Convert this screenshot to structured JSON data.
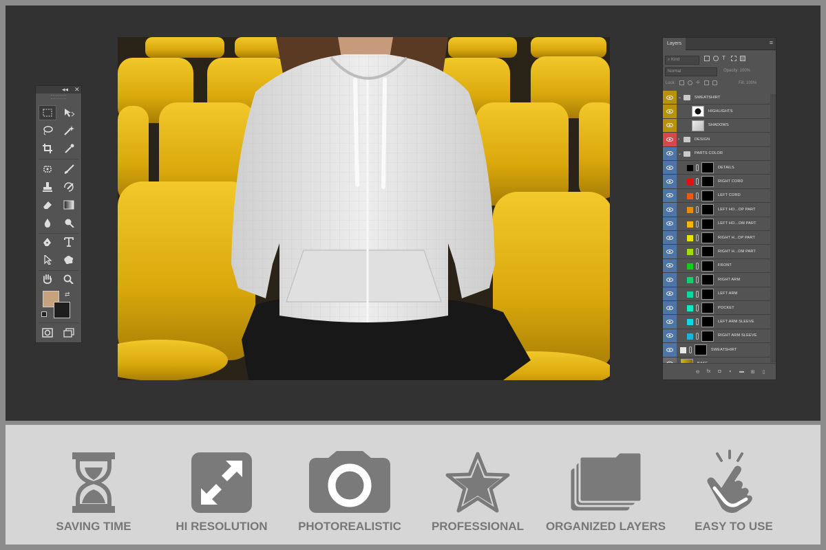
{
  "tools_panel": {
    "collapse_label": "◂◂",
    "close_label": "✕",
    "foreground_color": "#c7a37d",
    "background_color": "#1e1e1e"
  },
  "layers_panel": {
    "tab_label": "Layers",
    "filter_label": "Kind",
    "blend_mode": "Normal",
    "opacity_label": "Opacity: 100%",
    "lock_label": "Lock:",
    "fill_label": "Fill: 100%",
    "layers": [
      {
        "name": "SWEATSHIRT",
        "type": "group",
        "expanded": true,
        "tag_color": "#b8920a",
        "indent": 0
      },
      {
        "name": "HIGHLIGHTS",
        "type": "thumb",
        "tag_color": "#b8920a",
        "indent": 1
      },
      {
        "name": "SHADOWS",
        "type": "thumb",
        "tag_color": "#b8920a",
        "indent": 1
      },
      {
        "name": "DESIGN",
        "type": "group",
        "expanded": false,
        "tag_color": "#d34a4a",
        "indent": 0
      },
      {
        "name": "PARTS COLOR",
        "type": "group",
        "expanded": true,
        "tag_color": "#4d75a8",
        "indent": 0
      },
      {
        "name": "DETAILS",
        "type": "color",
        "swatch": "#000000",
        "tag_color": "#4d75a8",
        "indent": 1
      },
      {
        "name": "RIGHT CORD",
        "type": "color",
        "swatch": "#e31010",
        "tag_color": "#4d75a8",
        "indent": 1
      },
      {
        "name": "LEFT CORD",
        "type": "color",
        "swatch": "#f05a0a",
        "tag_color": "#4d75a8",
        "indent": 1
      },
      {
        "name": "LEFT HO...OP PART",
        "type": "color",
        "swatch": "#f28a00",
        "tag_color": "#4d75a8",
        "indent": 1
      },
      {
        "name": "LEFT HO...OM PART",
        "type": "color",
        "swatch": "#f5b800",
        "tag_color": "#4d75a8",
        "indent": 1
      },
      {
        "name": "RIGHT H...OP PART",
        "type": "color",
        "swatch": "#f0e000",
        "tag_color": "#4d75a8",
        "indent": 1
      },
      {
        "name": "RIGHT H...OM PART",
        "type": "color",
        "swatch": "#a0e000",
        "tag_color": "#4d75a8",
        "indent": 1
      },
      {
        "name": "FRONT",
        "type": "color",
        "swatch": "#10d010",
        "tag_color": "#4d75a8",
        "indent": 1
      },
      {
        "name": "RIGHT ARM",
        "type": "color",
        "swatch": "#10d070",
        "tag_color": "#4d75a8",
        "indent": 1
      },
      {
        "name": "LEFT ARM",
        "type": "color",
        "swatch": "#10d8a0",
        "tag_color": "#4d75a8",
        "indent": 1
      },
      {
        "name": "POCKET",
        "type": "color",
        "swatch": "#10e8c8",
        "tag_color": "#4d75a8",
        "indent": 1
      },
      {
        "name": "LEFT ARM SLEEVE",
        "type": "color",
        "swatch": "#10d8e8",
        "tag_color": "#4d75a8",
        "indent": 1
      },
      {
        "name": "RIGHT ARM SLEEVE",
        "type": "color",
        "swatch": "#10b8e8",
        "tag_color": "#4d75a8",
        "indent": 1
      },
      {
        "name": "SWEATSHIRT",
        "type": "color",
        "swatch": "#e8e8e8",
        "tag_color": "#4d75a8",
        "indent": 0
      },
      {
        "name": "BASE",
        "type": "base",
        "tag_color": "#6a6a6a",
        "indent": 0
      }
    ]
  },
  "features": [
    {
      "label": "SAVING TIME",
      "icon": "hourglass-icon"
    },
    {
      "label": "HI RESOLUTION",
      "icon": "expand-arrows-icon"
    },
    {
      "label": "PHOTOREALISTIC",
      "icon": "camera-icon"
    },
    {
      "label": "PROFESSIONAL",
      "icon": "star-icon"
    },
    {
      "label": "ORGANIZED LAYERS",
      "icon": "stacked-layers-icon"
    },
    {
      "label": "EASY TO USE",
      "icon": "tap-hand-icon"
    }
  ],
  "colors": {
    "workspace": "#323232",
    "feature_band": "#d6d6d6",
    "icon_gray": "#7a7a7a",
    "seat_yellow": "#e6b812"
  }
}
